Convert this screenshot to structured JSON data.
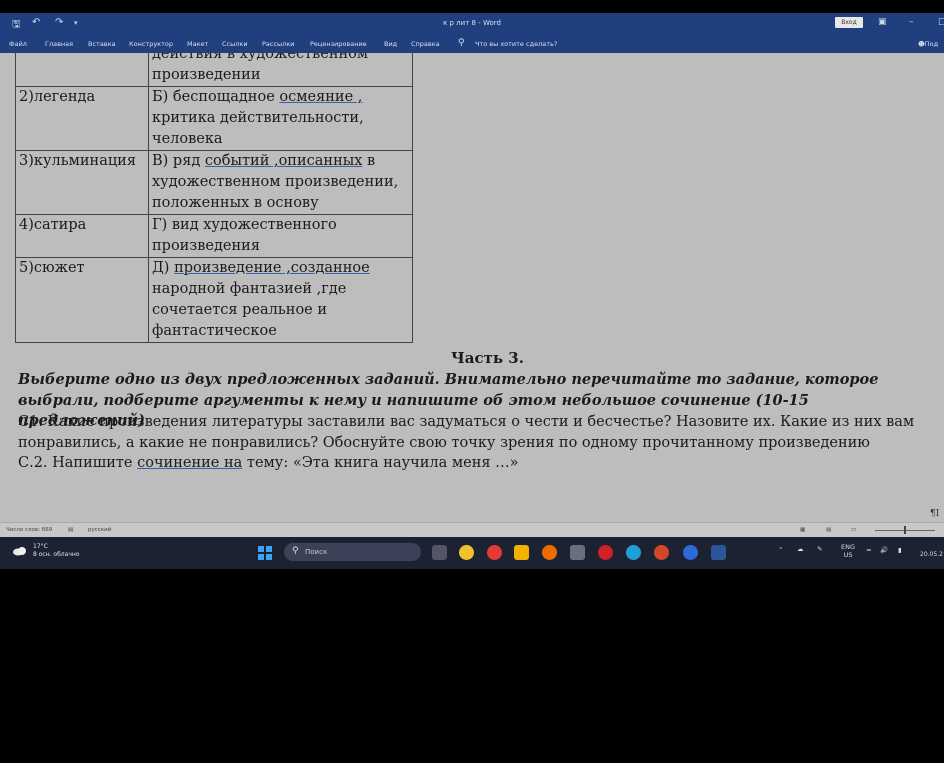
{
  "window": {
    "title": "к р лит 8  -  Word",
    "signin_label": "Вход",
    "share_label": "Под"
  },
  "ribbon": {
    "tabs": [
      "Файл",
      "Главная",
      "Вставка",
      "Конструктор",
      "Макет",
      "Ссылки",
      "Рассылки",
      "Рецензирование",
      "Вид",
      "Справка"
    ],
    "tell_me": "Что вы хотите сделать?"
  },
  "table": {
    "rows": [
      {
        "term": "",
        "definition": "действия в художественном произведении"
      },
      {
        "term": "2)легенда",
        "definition_pre": "Б) беспощадное ",
        "definition_ul": "осмеяние ,",
        "definition_post": " критика действительности, человека"
      },
      {
        "term": "3)кульминация",
        "definition_pre": "В) ряд ",
        "definition_ul": "событий ,описанных",
        "definition_post": " в художественном произведении, положенных в основу"
      },
      {
        "term": "4)сатира",
        "definition": "Г) вид художественного произведения"
      },
      {
        "term": "5)сюжет",
        "definition_pre": "Д) ",
        "definition_ul": "произведение ,созданное",
        "definition_post": " народной фантазией ,где сочетается реальное и фантастическое"
      }
    ]
  },
  "document": {
    "part_title": "Часть 3.",
    "task_instruction": "Выберите одно из двух предложенных заданий. Внимательно перечитайте то задание, которое выбрали, подберите аргументы к нему и напишите об этом небольшое сочинение (10-15 предложений)",
    "c1": "С1. Какие произведения литературы заставили вас задуматься о чести и бесчестье? Назовите их. Какие из них вам понравились, а какие не понравились? Обоснуйте свою точку зрения по одному прочитанному произведению",
    "c2_pre": "С.2. Напишите ",
    "c2_ul": "сочинение  на",
    "c2_post": " тему:  «Эта книга научила меня …»"
  },
  "statusbar": {
    "word_count": "Число слов: 669",
    "language": "русский"
  },
  "taskbar": {
    "temperature": "17°C",
    "weather": "8 осн. облачно",
    "search_placeholder": "Поиск",
    "lang_top": "ENG",
    "lang_bottom": "US",
    "date": "20.05.2"
  },
  "colors": {
    "title_bar": "#1f3f7f",
    "doc_background": "#bdbdbd",
    "taskbar": "#1d2233"
  }
}
